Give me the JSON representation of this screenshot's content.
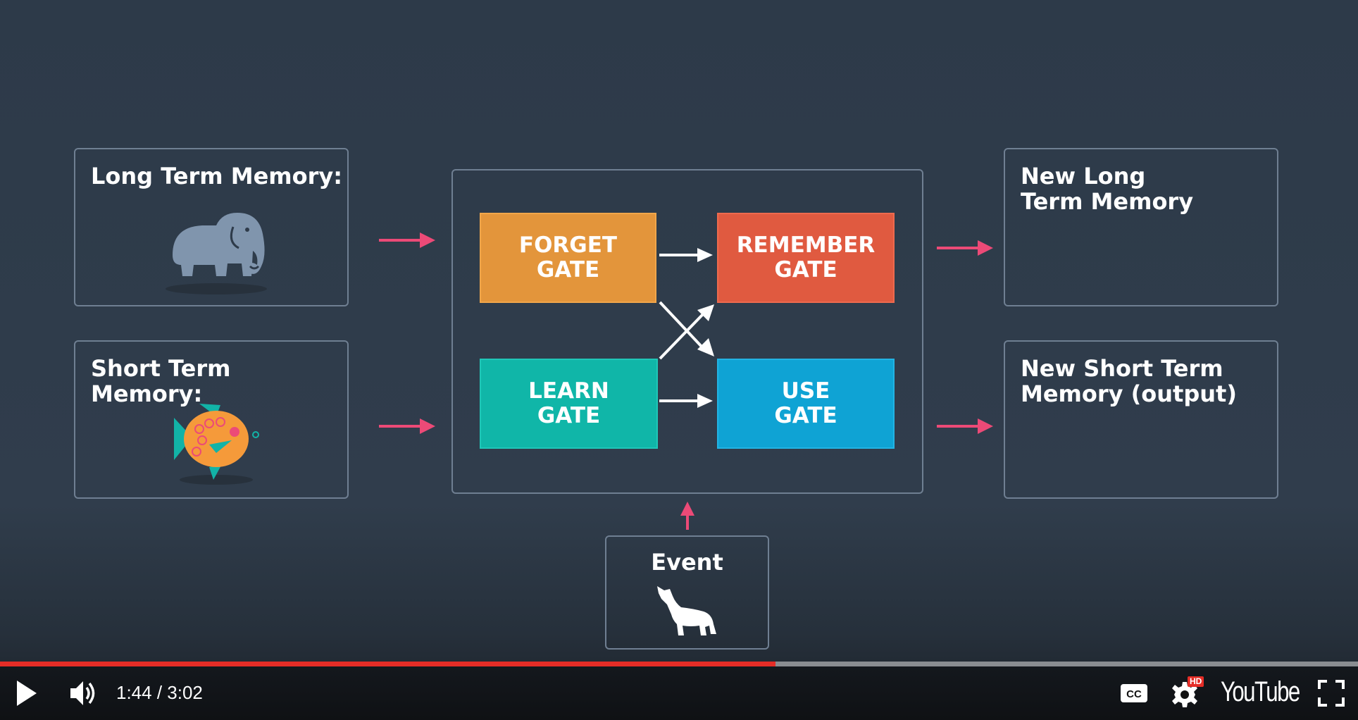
{
  "diagram": {
    "long_term_memory": "Long Term Memory:",
    "short_term_memory": "Short Term Memory:",
    "new_long_term": "New Long\nTerm Memory",
    "new_short_term": "New Short Term\nMemory (output)",
    "event": "Event",
    "gates": {
      "forget": "FORGET\nGATE",
      "remember": "REMEMBER\nGATE",
      "learn": "LEARN\nGATE",
      "use": "USE\nGATE"
    },
    "colors": {
      "forget": "#e3953b",
      "remember": "#e05a40",
      "learn": "#10b6a8",
      "use": "#0fa3d4",
      "input_arrow": "#ec4a77"
    },
    "icons": [
      "elephant-icon",
      "fish-icon",
      "wolf-icon"
    ]
  },
  "player": {
    "current_time": "1:44",
    "duration": "3:02",
    "time_display": "1:44 / 3:02",
    "progress_fraction": 0.571,
    "hd_badge": "HD",
    "brand": "YouTube",
    "icons": [
      "play-icon",
      "volume-icon",
      "captions-icon",
      "settings-icon",
      "fullscreen-icon"
    ]
  }
}
